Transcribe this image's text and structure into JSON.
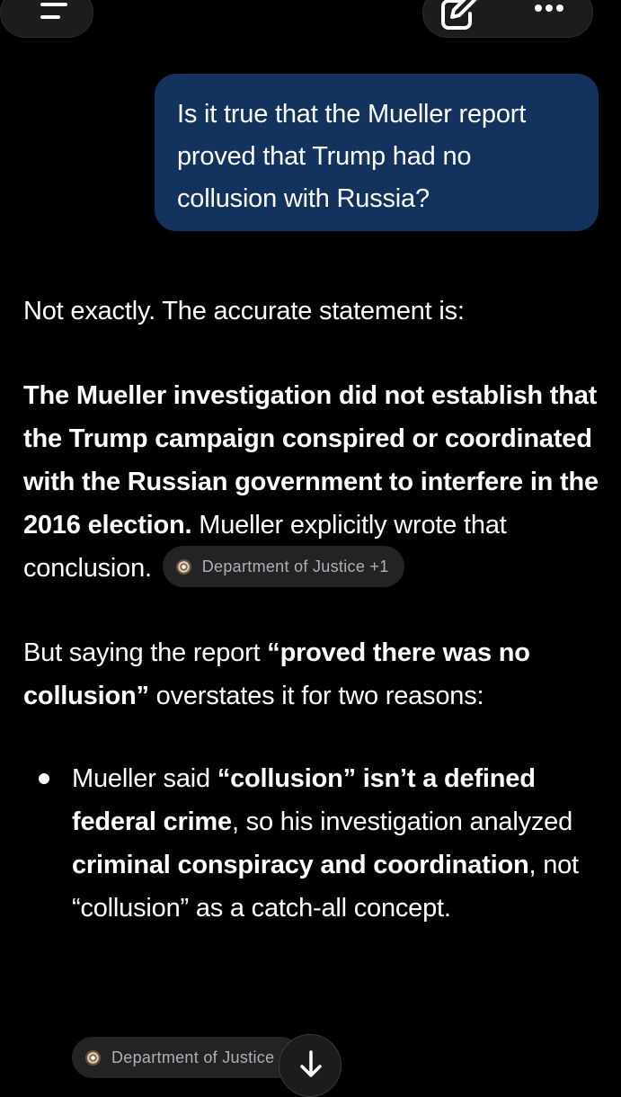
{
  "conversation": {
    "user_message": "Is it true that the Mueller report proved that Trump had no collusion with Russia?",
    "response": {
      "p1": "Not exactly. The accurate statement is:",
      "p2_bold": "The Mueller investigation did not establish that the Trump campaign conspired or coordinated with the Russian government to interfere in the 2016 election.",
      "p2_rest": " Mueller explicitly wrote that conclusion.",
      "p2_citation": "Department of Justice +1",
      "p3_start": "But saying the report ",
      "p3_bold": "“proved there was no collusion”",
      "p3_end": " overstates it for two reasons:",
      "bullet1": {
        "t1": "Mueller said ",
        "b1": "“collusion” isn’t a defined federal crime",
        "t2": ", so his investigation analyzed ",
        "b2": "criminal conspiracy and coordination",
        "t3": ", not “collusion” as a catch-all concept."
      },
      "bullet1_citation": "Department of Justice"
    }
  },
  "icons": {
    "menu": "menu-icon",
    "compose": "compose-icon",
    "more": "more-icon",
    "scroll_down": "arrow-down-icon",
    "citation_source": "doj-seal-icon"
  },
  "colors": {
    "background": "#000000",
    "user_bubble": "#13325e",
    "chip_background": "#232325",
    "chip_text": "#b0b0b5"
  }
}
